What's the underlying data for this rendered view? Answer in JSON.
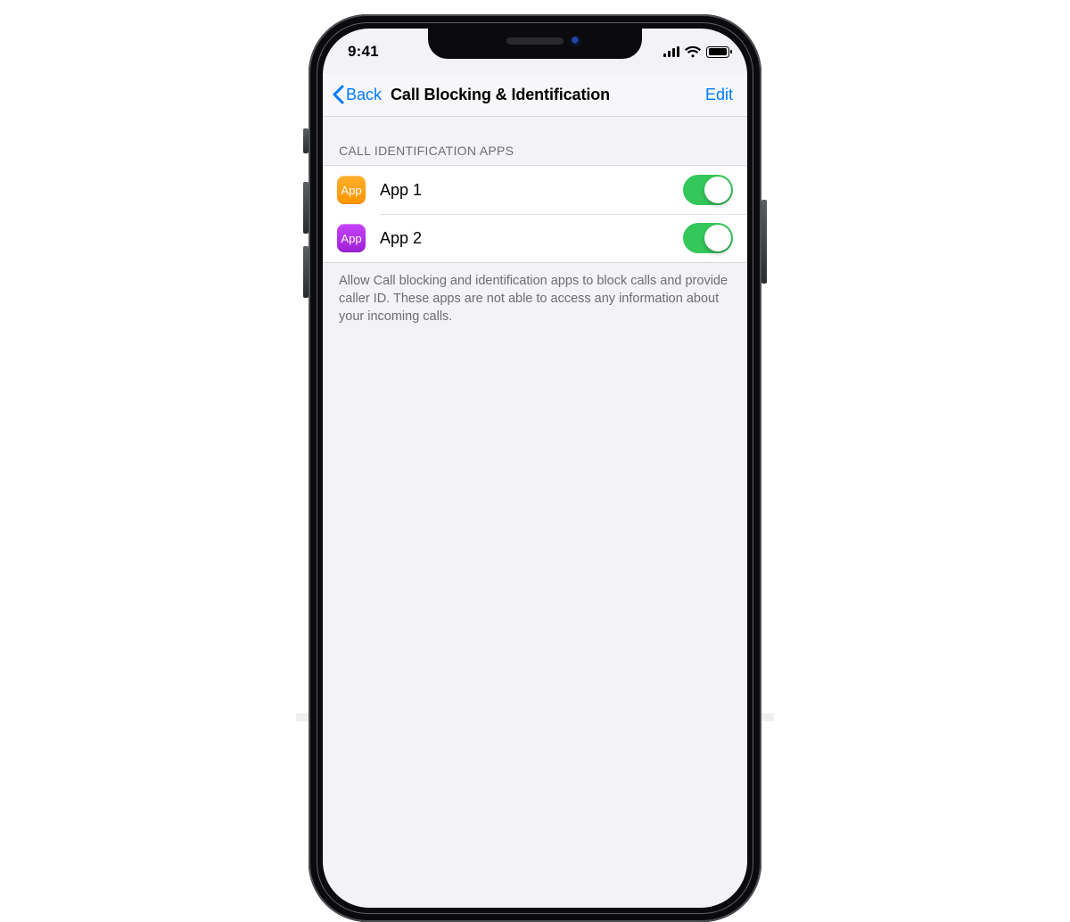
{
  "status": {
    "time": "9:41"
  },
  "nav": {
    "back_label": "Back",
    "title": "Call Blocking & Identification",
    "edit_label": "Edit"
  },
  "section": {
    "header": "CALL IDENTIFICATION APPS",
    "footer": "Allow Call blocking and identification apps to block calls and provide caller ID. These apps are not able to access any information about your incoming calls.",
    "apps": [
      {
        "name": "App 1",
        "icon_text": "App",
        "icon_color": "orange",
        "enabled": true
      },
      {
        "name": "App 2",
        "icon_text": "App",
        "icon_color": "purple",
        "enabled": true
      }
    ]
  }
}
